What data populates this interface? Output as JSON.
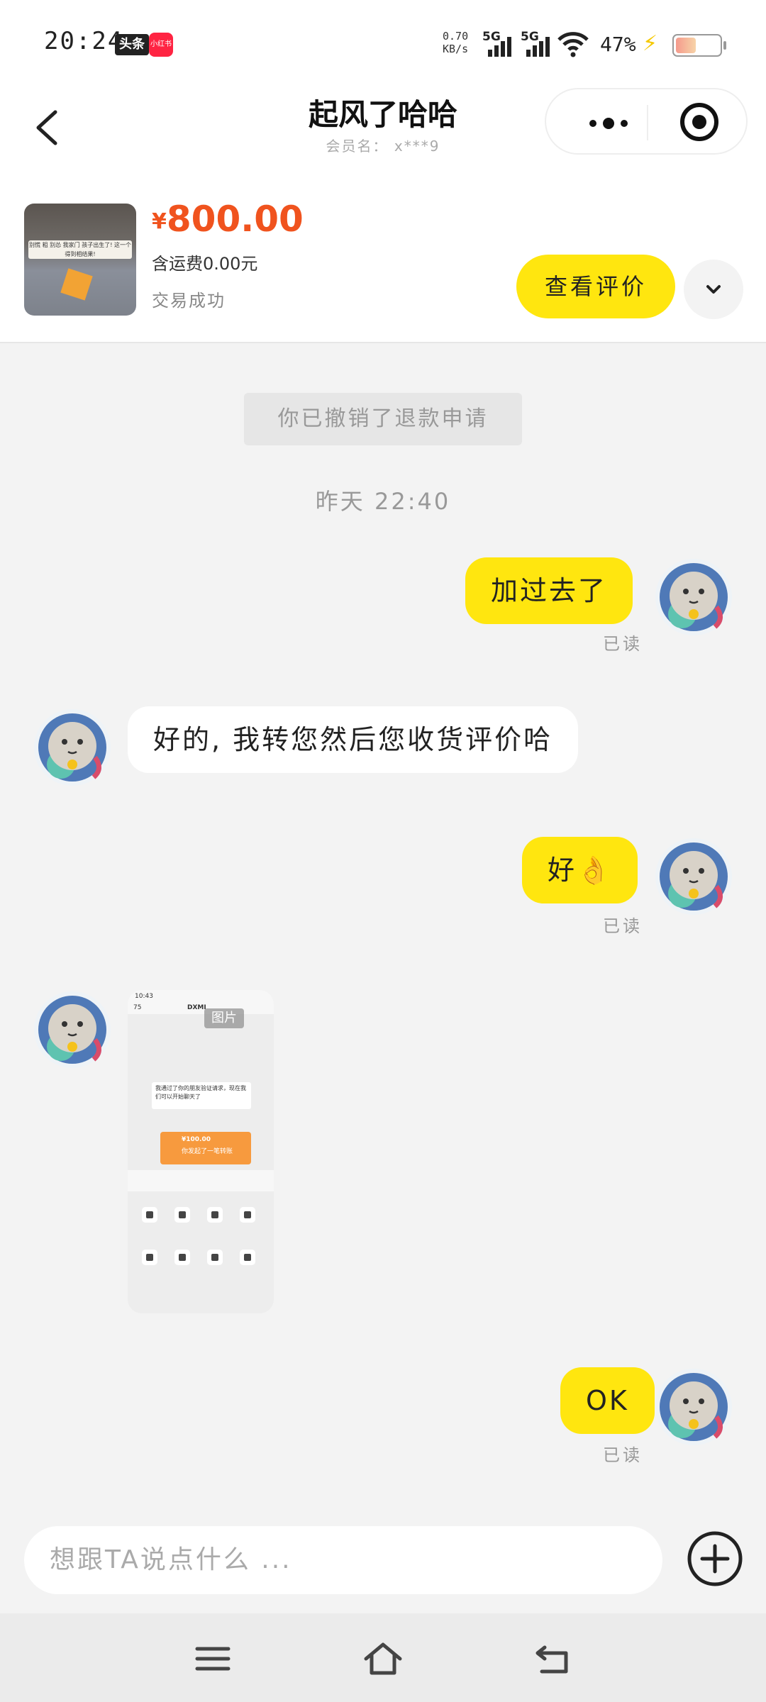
{
  "status_bar": {
    "time": "20:24",
    "app_badge_1": "头条",
    "app_badge_2": "小红书",
    "net_speed_value": "0.70",
    "net_speed_unit": "KB/s",
    "sim1": "5G",
    "sim2": "5G",
    "battery": "47%"
  },
  "header": {
    "title": "起风了哈哈",
    "subtitle": "会员名： x***9",
    "more_icon": "more-dots-icon",
    "target_icon": "target-icon"
  },
  "product": {
    "currency": "¥",
    "price": "800.00",
    "shipping": "含运费0.00元",
    "status": "交易成功",
    "review_button": "查看评价",
    "thumb_caption": "别慌 粗 别怂 我家门 孩子出生了! 这一个得到相结果!"
  },
  "chat": {
    "system_notice": "你已撤销了退款申请",
    "timestamp": "昨天 22:40",
    "messages": [
      {
        "from": "me",
        "text": "加过去了",
        "read": "已读"
      },
      {
        "from": "them",
        "text": "好的, 我转您然后您收货评价哈"
      },
      {
        "from": "me",
        "text": "好👌",
        "read": "已读"
      },
      {
        "from": "them",
        "type": "image",
        "label": "图片"
      },
      {
        "from": "me",
        "text": "OK",
        "read": "已读"
      }
    ],
    "image_preview": {
      "time": "10:43",
      "title": "DXMI",
      "back_count": "75",
      "message": "我通过了你的朋友验证请求，现在我们可以开始聊天了",
      "transfer_amount": "¥100.00",
      "transfer_note": "你发起了一笔转账"
    }
  },
  "composer": {
    "placeholder": "想跟TA说点什么 ..."
  },
  "colors": {
    "accent_yellow": "#ffe60f",
    "price_orange": "#f0531e",
    "background": "#f3f3f3"
  }
}
